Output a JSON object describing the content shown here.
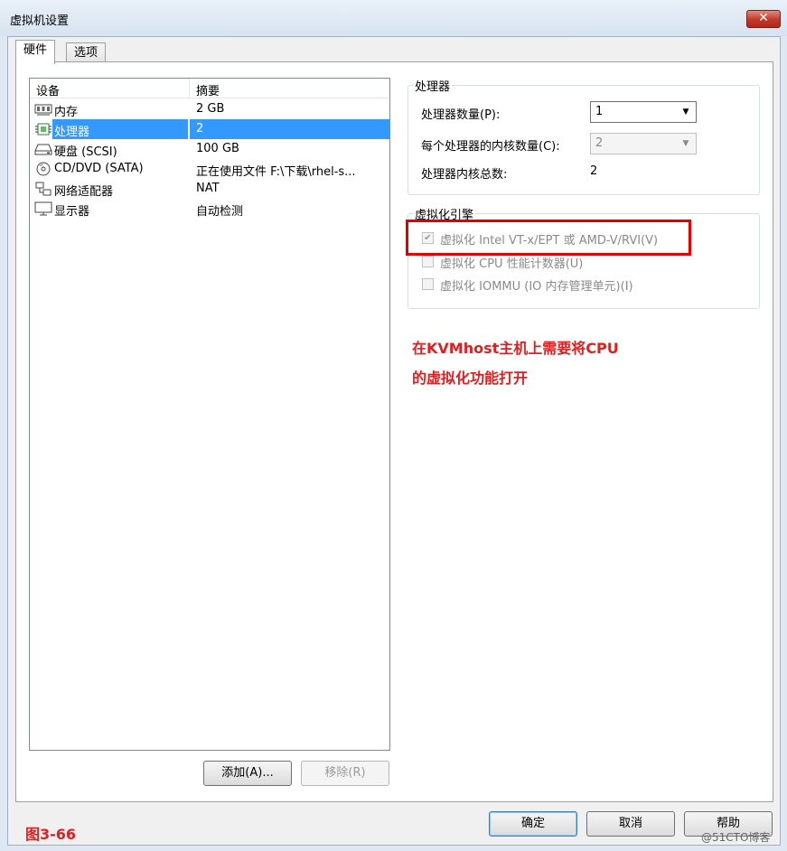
{
  "window": {
    "title": "虚拟机设置",
    "close": "✕"
  },
  "tabs": [
    {
      "label": "硬件"
    },
    {
      "label": "选项"
    }
  ],
  "device_list": {
    "headers": {
      "device": "设备",
      "summary": "摘要"
    },
    "rows": [
      {
        "icon": "memory-icon",
        "device": "内存",
        "summary": "2 GB"
      },
      {
        "icon": "processor-icon",
        "device": "处理器",
        "summary": "2"
      },
      {
        "icon": "hard-disk-icon",
        "device": "硬盘 (SCSI)",
        "summary": "100 GB"
      },
      {
        "icon": "cd-dvd-icon",
        "device": "CD/DVD (SATA)",
        "summary": "正在使用文件 F:\\下载\\rhel-s..."
      },
      {
        "icon": "network-adapter-icon",
        "device": "网络适配器",
        "summary": "NAT"
      },
      {
        "icon": "display-icon",
        "device": "显示器",
        "summary": "自动检测"
      }
    ]
  },
  "list_buttons": {
    "add": "添加(A)...",
    "remove": "移除(R)"
  },
  "processor_group": {
    "title": "处理器",
    "count_label": "处理器数量(P):",
    "count_value": "1",
    "cores_label": "每个处理器的内核数量(C):",
    "cores_value": "2",
    "total_label": "处理器内核总数:",
    "total_value": "2"
  },
  "virt_group": {
    "title": "虚拟化引擎",
    "vt_label": "虚拟化 Intel VT-x/EPT 或 AMD-V/RVI(V)",
    "cpu_counter_label": "虚拟化 CPU 性能计数器(U)",
    "iommu_label": "虚拟化 IOMMU (IO 内存管理单元)(I)"
  },
  "annotation": {
    "line1": "在KVMhost主机上需要将CPU",
    "line2": "的虚拟化功能打开"
  },
  "figure_label": "图3-66",
  "dialog_buttons": {
    "ok": "确定",
    "cancel": "取消",
    "help": "帮助"
  },
  "watermark": "@51CTO博客",
  "colors": {
    "selection": "#3399ff",
    "highlight_box": "#e10000",
    "annotation": "#e02020"
  }
}
